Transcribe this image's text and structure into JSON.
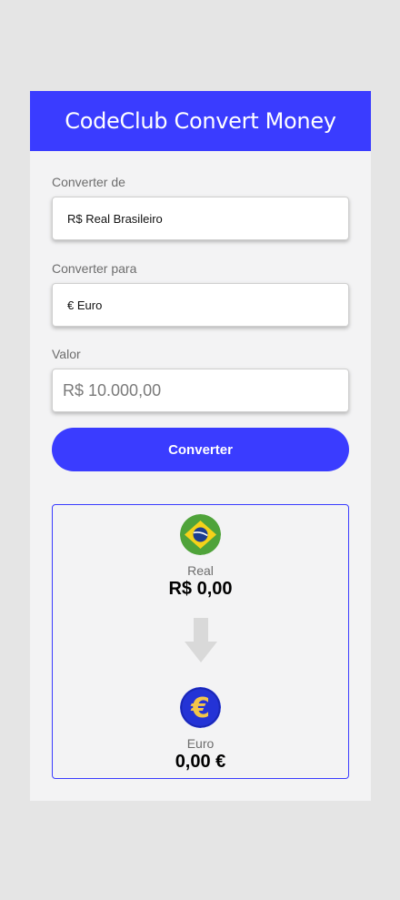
{
  "header": {
    "title": "CodeClub Convert Money"
  },
  "from": {
    "label": "Converter de",
    "selected": "R$ Real Brasileiro"
  },
  "to": {
    "label": "Converter para",
    "selected": "€ Euro"
  },
  "amount": {
    "label": "Valor",
    "placeholder": "R$ 10.000,00"
  },
  "convert_button": {
    "label": "Converter"
  },
  "result": {
    "source": {
      "name": "Real",
      "value": "R$ 0,00",
      "icon": "brazil-flag-icon"
    },
    "target": {
      "name": "Euro",
      "value": "0,00 €",
      "icon": "euro-icon"
    },
    "arrow_icon": "arrow-down-icon"
  },
  "colors": {
    "accent": "#3a3cff",
    "card_bg": "#f3f3f4",
    "page_bg": "#e5e5e5"
  }
}
